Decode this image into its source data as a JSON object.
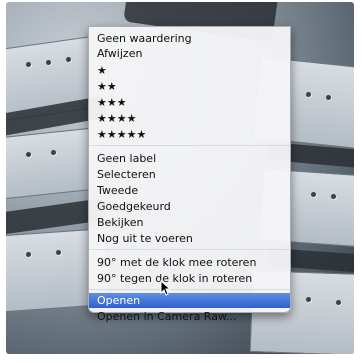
{
  "menu": {
    "items": [
      {
        "label": "Geen waardering"
      },
      {
        "label": "Afwijzen"
      },
      {
        "label": "★"
      },
      {
        "label": "★★"
      },
      {
        "label": "★★★"
      },
      {
        "label": "★★★★"
      },
      {
        "label": "★★★★★"
      },
      {
        "label": "Geen label"
      },
      {
        "label": "Selecteren"
      },
      {
        "label": "Tweede"
      },
      {
        "label": "Goedgekeurd"
      },
      {
        "label": "Bekijken"
      },
      {
        "label": "Nog uit te voeren"
      },
      {
        "label": "90° met de klok mee roteren"
      },
      {
        "label": "90° tegen de klok in roteren"
      },
      {
        "label": "Openen"
      },
      {
        "label": "Openen in Camera Raw..."
      }
    ],
    "highlighted_index": 15
  },
  "colors": {
    "highlight": "#3a6ad6",
    "menu_background": "#f5f5f7"
  }
}
